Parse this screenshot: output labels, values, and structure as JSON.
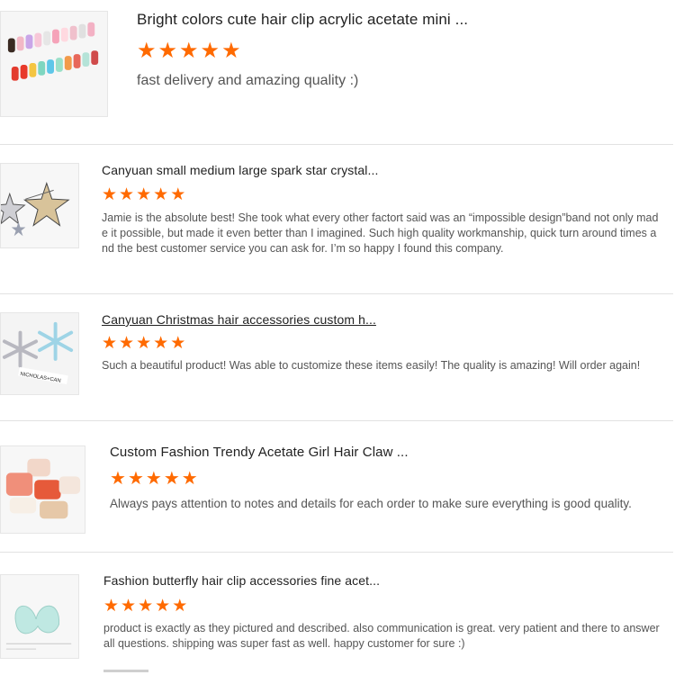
{
  "star_color": "#ff6a00",
  "reviews": [
    {
      "title": "Bright colors cute hair clip acrylic acetate mini ...",
      "rating": 5,
      "text": "fast delivery and amazing quality :)",
      "thumb_icon": "colorful-hair-clips-image"
    },
    {
      "title": "Canyuan small medium large spark star crystal...",
      "rating": 5,
      "text": "Jamie is the absolute best! She took what every other factort said was an “impossible design”band not only made it possible, but made it even better than I imagined. Such high quality workmanship, quick turn around times and the best customer service you can ask for. I’m so happy I found this company.",
      "thumb_icon": "star-crystal-clips-image"
    },
    {
      "title": "Canyuan Christmas hair accessories custom h...",
      "rating": 5,
      "text": "Such a beautiful product! Was able to customize these items easily! The quality is amazing! Will order again!",
      "thumb_icon": "snowflake-clips-image",
      "thumb_caption": "NICHOLAS+CAN"
    },
    {
      "title": "Custom Fashion Trendy Acetate Girl Hair Claw ...",
      "rating": 5,
      "text": "Always pays attention to notes and details for each order to make sure everything is good quality.",
      "thumb_icon": "hair-claw-image"
    },
    {
      "title": "Fashion butterfly hair clip accessories fine acet...",
      "rating": 5,
      "text": "product is exactly as they pictured and described. also communication is great. very patient and there to answer all questions. shipping was super fast as well. happy customer for sure :)",
      "thumb_icon": "butterfly-clip-image"
    }
  ]
}
